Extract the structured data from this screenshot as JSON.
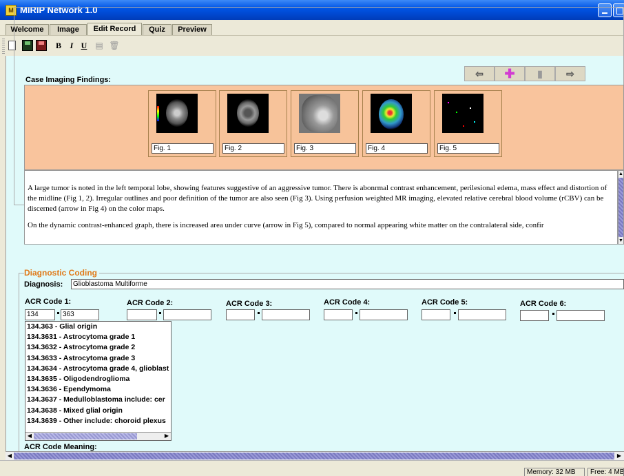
{
  "window": {
    "title": "MIRIP Network 1.0",
    "icon_text": "M"
  },
  "tabs": [
    "Welcome",
    "Image",
    "Edit Record",
    "Quiz",
    "Preview"
  ],
  "active_tab": "Edit Record",
  "toolbar": {
    "icons": [
      "new-document-icon",
      "save-icon",
      "save-as-icon",
      "bold-icon",
      "italic-icon",
      "underline-icon",
      "copy-icon",
      "trash-icon"
    ],
    "bold_glyph": "B",
    "italic_glyph": "I",
    "underline_glyph": "U"
  },
  "findings": {
    "label": "Case Imaging Findings:",
    "nav_icons": [
      "arrow-left-icon",
      "add-icon",
      "trash-icon",
      "arrow-right-icon"
    ],
    "figures": [
      {
        "caption": "Fig. 1"
      },
      {
        "caption": "Fig. 2"
      },
      {
        "caption": "Fig. 3"
      },
      {
        "caption": "Fig. 4"
      },
      {
        "caption": "Fig. 5"
      }
    ],
    "description": [
      "A large tumor is noted in the left temporal lobe, showing features suggestive of an aggressive tumor.  There is abonrmal contrast enhancement, perilesional edema, mass effect and distortion of the midline (Fig 1, 2). Irregular outlines and poor definition of the tumor are also seen (Fig 3).  Using perfusion weighted MR imaging, elevated relative cerebral blood volume (rCBV) can be discerned (arrow in Fig 4) on the color maps.",
      "On the dynamic contrast-enhanced graph, there is increased area under curve (arrow in Fig 5), compared to normal appearing white matter on the contralateral side, confir"
    ]
  },
  "coding": {
    "legend": "Diagnostic Coding",
    "diagnosis_label": "Diagnosis:",
    "diagnosis_value": "Glioblastoma Multiforme",
    "acr_codes": [
      {
        "label": "ACR Code 1:",
        "major": "134",
        "minor": "363"
      },
      {
        "label": "ACR Code 2:",
        "major": "",
        "minor": ""
      },
      {
        "label": "ACR Code 3:",
        "major": "",
        "minor": ""
      },
      {
        "label": "ACR Code 4:",
        "major": "",
        "minor": ""
      },
      {
        "label": "ACR Code 5:",
        "major": "",
        "minor": ""
      },
      {
        "label": "ACR Code 6:",
        "major": "",
        "minor": ""
      }
    ],
    "suggestions": [
      "134.363 - Glial origin",
      "134.3631 - Astrocytoma grade 1",
      "134.3632 - Astrocytoma grade 2",
      "134.3633 - Astrocytoma grade 3",
      "134.3634 - Astrocytoma grade 4, glioblast",
      "134.3635 - Oligodendroglioma",
      "134.3636 - Ependymoma",
      "134.3637 - Medulloblastoma  include: cer",
      "134.3638 - Mixed glial origin",
      "134.3639 - Other  include: choroid plexus"
    ],
    "meaning_label": "ACR Code Meaning:"
  },
  "status": {
    "memory": "Memory: 32 MB",
    "free": "Free: 4 MB"
  }
}
